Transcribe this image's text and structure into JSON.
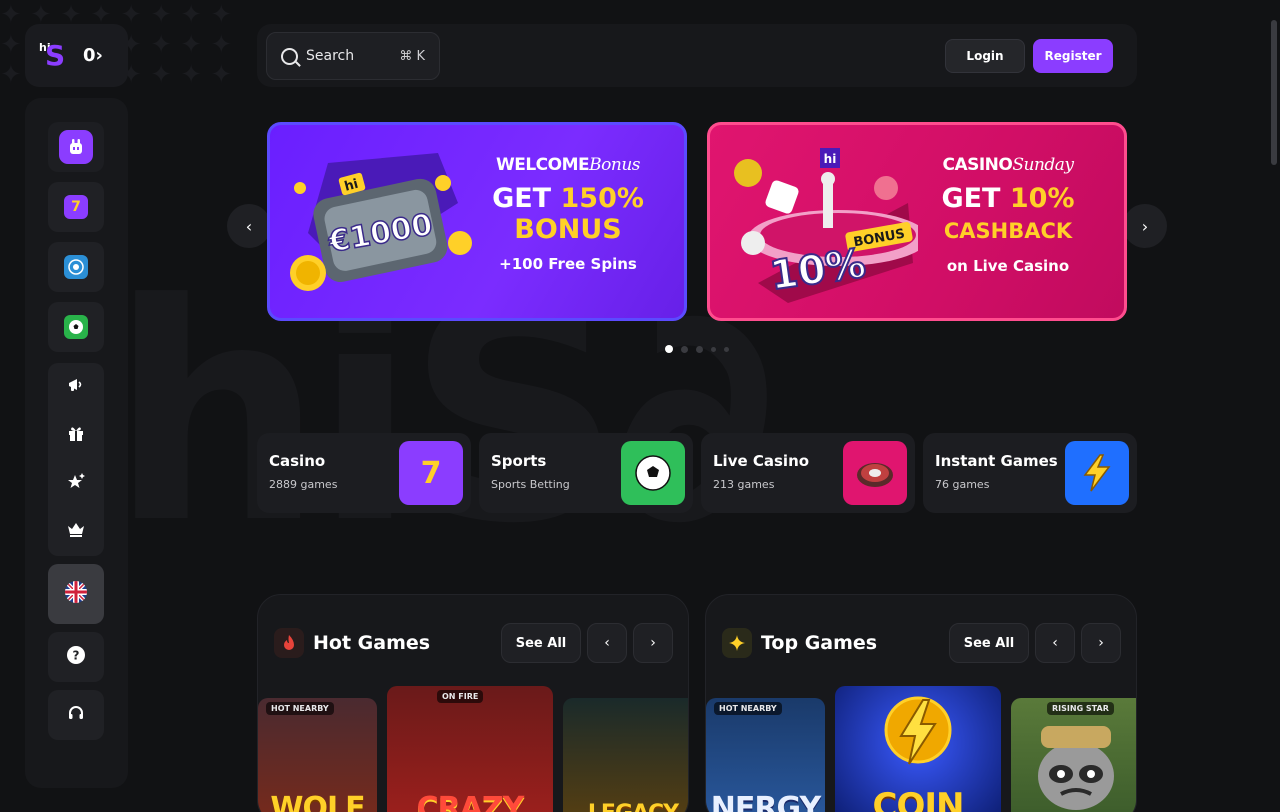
{
  "brand": {
    "logo_hi": "hi",
    "logo_s": "S",
    "rail_toggle": "0›"
  },
  "watermark": "hiS∂",
  "topbar": {
    "search_label": "Search",
    "search_shortcut": "⌘ K",
    "login_label": "Login",
    "register_label": "Register"
  },
  "sidebar": {
    "items": [
      {
        "name": "promo",
        "icon": "bunny-icon",
        "color": "#8b3dff"
      },
      {
        "name": "casino",
        "icon": "slot-seven-icon",
        "color": "#8b3dff"
      },
      {
        "name": "live-casino",
        "icon": "roulette-icon",
        "color": "#2b8fd6"
      },
      {
        "name": "sports",
        "icon": "soccer-ball-icon",
        "color": "#29b34a"
      },
      {
        "name": "promotions",
        "icon": "megaphone-icon"
      },
      {
        "name": "gift",
        "icon": "gift-icon"
      },
      {
        "name": "favorites",
        "icon": "sparkle-star-icon"
      },
      {
        "name": "vip",
        "icon": "crown-icon"
      },
      {
        "name": "language",
        "icon": "uk-flag-icon"
      },
      {
        "name": "help",
        "icon": "question-icon"
      },
      {
        "name": "support",
        "icon": "headset-icon"
      }
    ]
  },
  "banners": [
    {
      "head_plain": "WELCOME",
      "head_script": "Bonus",
      "line1_plain": "GET ",
      "line1_yellow": "150%",
      "line2_yellow": "BONUS",
      "sub": "+100 Free Spins",
      "art_text": "€1000",
      "art_badge": "hi"
    },
    {
      "head_plain": "CASINO",
      "head_script": "Sunday",
      "line1_plain": "GET ",
      "line1_yellow": "10%",
      "line2_yellow": "CASHBACK",
      "sub": "on Live Casino",
      "art_text": "10%",
      "art_badge": "BONUS",
      "art_hi": "hi"
    }
  ],
  "carousel": {
    "active_index": 0,
    "count": 5
  },
  "categories": [
    {
      "title": "Casino",
      "subtitle": "2889 games",
      "icon": "slot-seven-icon",
      "glyph": "7",
      "bg": "#8b3dff"
    },
    {
      "title": "Sports",
      "subtitle": "Sports Betting",
      "icon": "soccer-ball-icon",
      "glyph": "⚽",
      "bg": "#2fbf5a"
    },
    {
      "title": "Live Casino",
      "subtitle": "213 games",
      "icon": "roulette-icon",
      "glyph": "◎",
      "bg": "#e0156f"
    },
    {
      "title": "Instant Games",
      "subtitle": "76 games",
      "icon": "lightning-icon",
      "glyph": "⚡",
      "bg": "#1f6fff"
    }
  ],
  "hot_games": {
    "title": "Hot Games",
    "icon": "fire-icon",
    "see_all": "See All",
    "games": [
      {
        "badge": "HOT NEARBY",
        "name": "WOLF",
        "bg": "#7a2a1a"
      },
      {
        "badge": "ON FIRE",
        "name": "CRAZY",
        "bg": "#8a1c1c"
      },
      {
        "badge": "",
        "name": "LEGACY",
        "bg": "#3a2a10"
      }
    ]
  },
  "top_games": {
    "title": "Top Games",
    "icon": "sparkle-icon",
    "see_all": "See All",
    "games": [
      {
        "badge": "HOT NEARBY",
        "name": "NERGY",
        "bg": "#1a3a6a"
      },
      {
        "badge": "",
        "name": "COIN",
        "bg": "#1a2a8a"
      },
      {
        "badge": "RISING STAR",
        "name": "",
        "bg": "#3a5a2a"
      }
    ]
  }
}
